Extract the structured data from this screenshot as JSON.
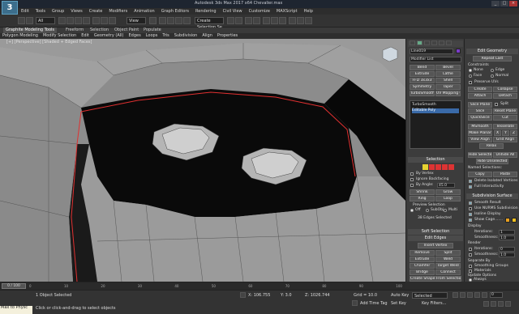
{
  "window": {
    "title": "Autodesk 3ds Max 2017 x64   Chevalier.max",
    "app_icon": "3",
    "win_controls": [
      "_",
      "□",
      "×"
    ]
  },
  "menu": [
    "Edit",
    "Tools",
    "Group",
    "Views",
    "Create",
    "Modifiers",
    "Animation",
    "Graph Editors",
    "Rendering",
    "Civil View",
    "Customize",
    "MAXScript",
    "Help"
  ],
  "toolbar": {
    "filter": "All",
    "view_ref": "View",
    "selection_set": "Create Selection Se"
  },
  "ribbon": {
    "tabs": [
      "Graphite Modeling Tools",
      "Freeform",
      "Selection",
      "Object Paint",
      "Populate"
    ],
    "active_tab": "Graphite Modeling Tools",
    "sub": [
      "Polygon Modeling",
      "Modify Selection",
      "Edit",
      "Geometry (All)",
      "Edges",
      "Loops",
      "Tris",
      "Subdivision",
      "Align",
      "Properties"
    ]
  },
  "viewport": {
    "label": "[+] [Perspective] [Shaded + Edged Faces]",
    "nav_icon": "cube-icon"
  },
  "command_panel": {
    "object_name": "Line019",
    "modifier_list": "Modifier List",
    "buttons": [
      "Bend",
      "Bevel",
      "Extrude",
      "Lathe",
      "FFD 3x3x3",
      "Shell",
      "Symmetry",
      "Taper",
      "TurboSmooth",
      "UV Mapping Op"
    ],
    "stack": [
      "TurboSmooth",
      "Editable Poly"
    ],
    "selection": {
      "header": "Selection",
      "by_vertex": "By Vertex",
      "ignore_backfacing": "Ignore Backfacing",
      "by_angle": "By Angle:",
      "by_angle_value": "45.0",
      "shrink": "Shrink",
      "grow": "Grow",
      "ring": "Ring",
      "loop": "Loop",
      "preview": "Preview Selection",
      "preview_off": "Off",
      "preview_subobj": "SubObj",
      "preview_multi": "Multi",
      "status": "38 Edges Selected"
    },
    "soft_selection": "Soft Selection",
    "edit_edges": {
      "header": "Edit Edges",
      "insert_vertex": "Insert Vertex",
      "remove": "Remove",
      "split": "Split",
      "extrude": "Extrude",
      "weld": "Weld",
      "chamfer": "Chamfer",
      "target_weld": "Target Weld",
      "bridge": "Bridge",
      "connect": "Connect",
      "create_shape": "Create Shape From Selection",
      "weight": "Weight:",
      "weight_value": "1.0",
      "crease": "Crease:",
      "crease_value": "0.0"
    }
  },
  "edit_geometry": {
    "header": "Edit Geometry",
    "repeat_last": "Repeat Last",
    "constraints": "Constraints",
    "none": "None",
    "edge": "Edge",
    "face": "Face",
    "normal": "Normal",
    "preserve_uvs": "Preserve UVs",
    "create": "Create",
    "collapse": "Collapse",
    "attach": "Attach",
    "detach": "Detach",
    "slice_plane": "Slice Plane",
    "split": "Split",
    "slice": "Slice",
    "reset_plane": "Reset Plane",
    "quickslice": "QuickSlice",
    "cut": "Cut",
    "msmooth": "MSmooth",
    "tessellate": "Tessellate",
    "make_planar": "Make Planar",
    "x": "X",
    "y": "Y",
    "z": "Z",
    "view_align": "View Align",
    "grid_align": "Grid Align",
    "relax": "Relax",
    "hide_selected": "Hide Selected",
    "unhide_all": "Unhide All",
    "hide_unselected": "Hide Unselected",
    "named_selections": "Named Selections:",
    "copy": "Copy",
    "paste": "Paste",
    "delete_isolated": "Delete Isolated Vertices",
    "full_interactivity": "Full Interactivity"
  },
  "subdivision_surface": {
    "header": "Subdivision Surface",
    "smooth_result": "Smooth Result",
    "use_nurms": "Use NURMS Subdivision",
    "isoline": "Isoline Display",
    "show_cage": "Show Cage.......",
    "display": "Display",
    "iterations": "Iterations:",
    "iterations_value": "1",
    "smoothness": "Smoothness:",
    "smoothness_value": "1.0",
    "render": "Render",
    "r_iterations_value": "0",
    "r_smoothness_value": "1.0",
    "separate_by": "Separate By",
    "smoothing_groups": "Smoothing Groups",
    "materials": "Materials",
    "update_options": "Update Options",
    "always": "Always",
    "when_rendering": "When Rendering",
    "manually": "Manually",
    "cage_colors": [
      "#e8a020",
      "#f0c020"
    ]
  },
  "timeline": {
    "frame": "0 / 100",
    "ticks": [
      "0",
      "10",
      "20",
      "30",
      "40",
      "50",
      "60",
      "70",
      "80",
      "90",
      "100"
    ]
  },
  "status": {
    "maxscript_line1": "Max to Physc",
    "maxscript_line2": "",
    "selected": "1 Object Selected",
    "prompt": "Click or click-and-drag to select objects",
    "x": "X: 106.755",
    "y": "Y: 3.0",
    "z": "Z: 1026.744",
    "grid": "Grid = 10.0",
    "add_time_tag": "Add Time Tag",
    "auto_key": "Auto Key",
    "selected_dd": "Selected",
    "set_key": "Set Key",
    "key_filters": "Key Filters...",
    "frame_value": "0"
  }
}
